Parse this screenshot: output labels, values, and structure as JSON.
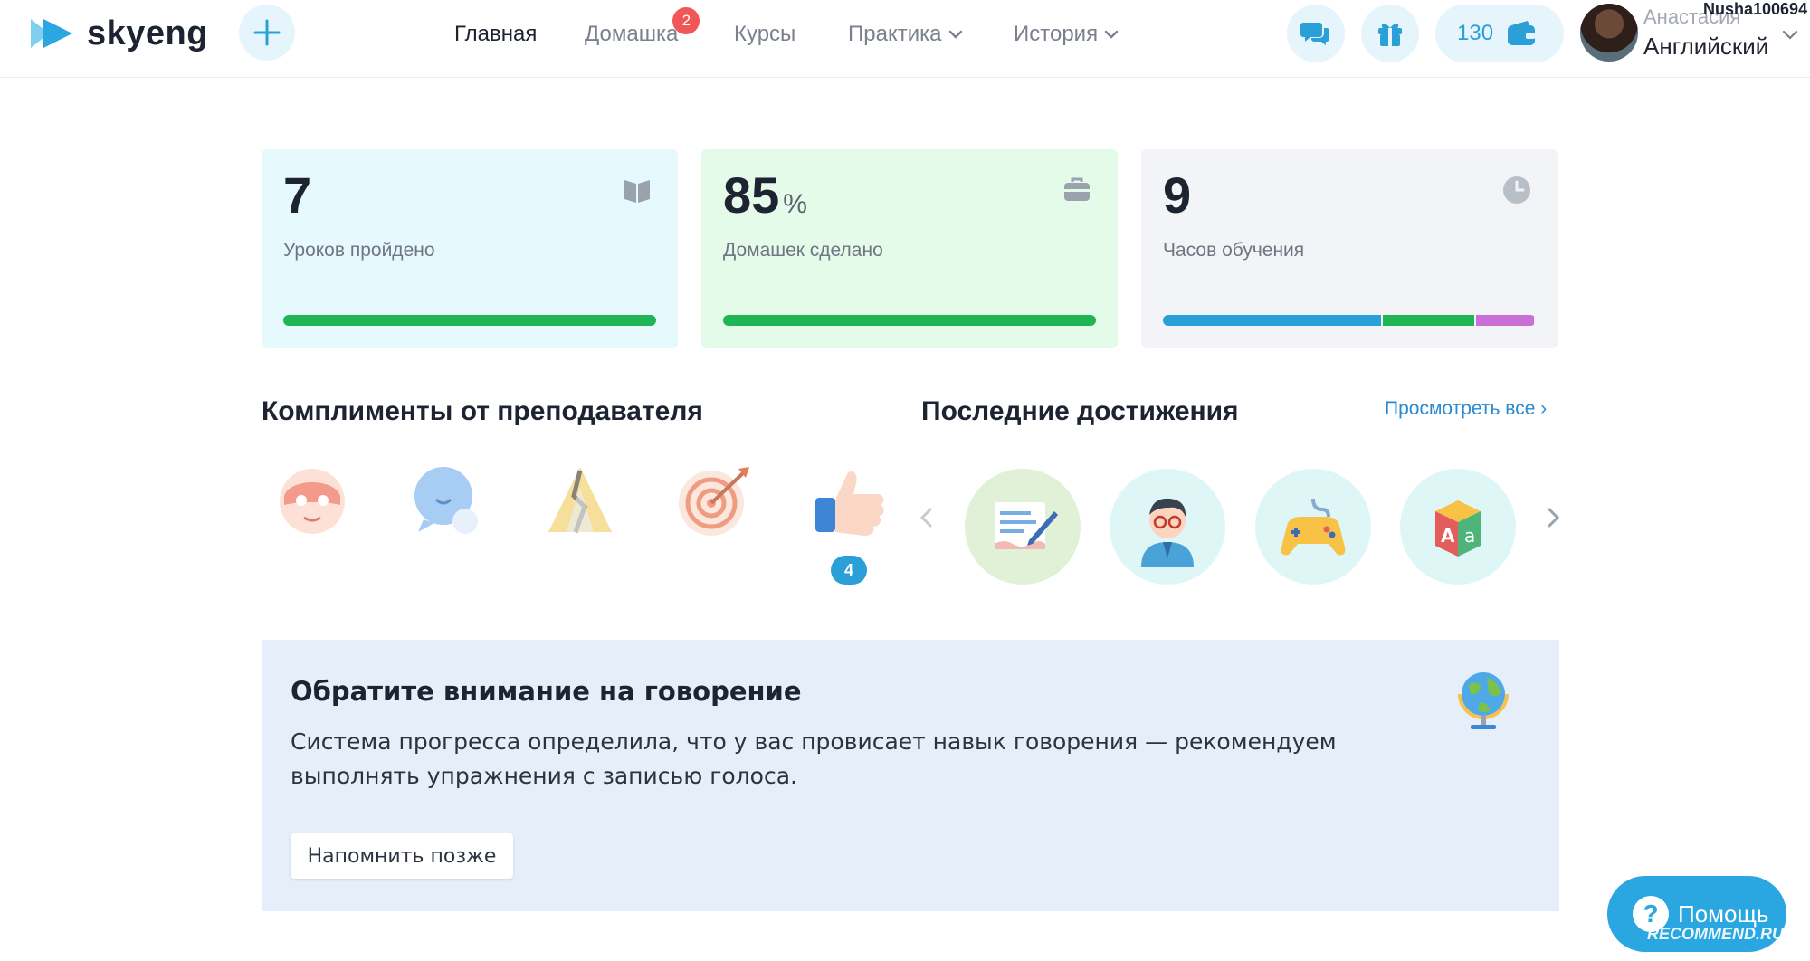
{
  "app": {
    "brand": "skyeng",
    "colors": {
      "accent": "#2a9fd8",
      "badge": "#f25757",
      "green": "#1fb554",
      "blue": "#2a9fd8",
      "purple": "#c86fd8"
    }
  },
  "nav": {
    "items": [
      {
        "label": "Главная",
        "active": true
      },
      {
        "label": "Домашка",
        "badge": "2"
      },
      {
        "label": "Курсы"
      },
      {
        "label": "Практика",
        "dropdown": true
      },
      {
        "label": "История",
        "dropdown": true
      }
    ]
  },
  "header": {
    "balance": "130",
    "user_name": "Анастасия",
    "course": "Английский",
    "watermark_user": "Nusha100694"
  },
  "stats": [
    {
      "value": "7",
      "label": "Уроков пройдено",
      "icon": "book-icon",
      "bg": "#e6f9fd",
      "progress": 1.0
    },
    {
      "value": "85",
      "unit": "%",
      "label": "Домашек сделано",
      "icon": "briefcase-icon",
      "bg": "#e4fbe9",
      "progress": 1.0
    },
    {
      "value": "9",
      "label": "Часов обучения",
      "icon": "clock-icon",
      "bg": "#f2f4f7",
      "segments": [
        0.59,
        0.25,
        0.16
      ]
    }
  ],
  "compliments": {
    "title": "Комплименты от преподавателя",
    "items": [
      "superhero-mask-icon",
      "chat-bubbles-icon",
      "broken-lock-icon",
      "target-icon",
      "thumbs-up-icon"
    ],
    "thumbs_count": "4"
  },
  "achievements": {
    "title": "Последние достижения",
    "view_all": "Просмотреть все ›",
    "items": [
      "document-pen-icon",
      "teacher-icon",
      "gamepad-icon",
      "alphabet-cube-icon"
    ]
  },
  "notice": {
    "title": "Обратите внимание на говорение",
    "text": "Система прогресса определила, что у вас провисает навык говорения — рекомендуем выполнять упражнения с записью голоса.",
    "button": "Напомнить позже"
  },
  "help": {
    "label": "Помощь",
    "watermark": "RECOMMEND.RU"
  }
}
